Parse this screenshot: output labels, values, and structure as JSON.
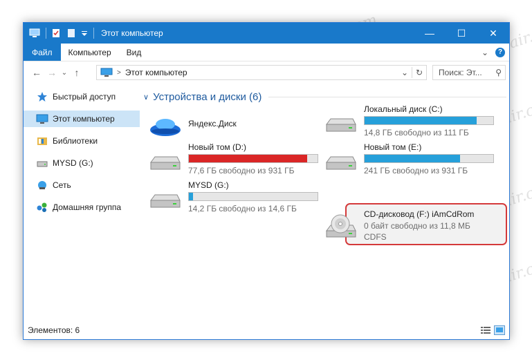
{
  "window": {
    "title": "Этот компьютер",
    "controls": {
      "minimize": "—",
      "maximize": "☐",
      "close": "✕"
    }
  },
  "ribbon": {
    "tabs": [
      "Файл",
      "Компьютер",
      "Вид"
    ],
    "help": "?",
    "expand": "⌄"
  },
  "nav": {
    "back": "←",
    "forward": "→",
    "recent": "⌄",
    "up": "↑",
    "address": "Этот компьютер",
    "crumb_sep": ">",
    "dropdown": "⌄",
    "refresh": "↻",
    "search_placeholder": "Поиск: Эт...",
    "search_icon": "⚲"
  },
  "sidebar": {
    "items": [
      {
        "label": "Быстрый доступ",
        "icon": "star-icon"
      },
      {
        "label": "Этот компьютер",
        "icon": "computer-icon",
        "selected": true
      },
      {
        "label": "Библиотеки",
        "icon": "library-icon"
      },
      {
        "label": "MYSD (G:)",
        "icon": "drive-icon"
      },
      {
        "label": "Сеть",
        "icon": "network-icon"
      },
      {
        "label": "Домашняя группа",
        "icon": "homegroup-icon"
      }
    ]
  },
  "content": {
    "group_chevron": "∨",
    "group_title": "Устройства и диски (6)",
    "drives": [
      {
        "id": "yandex",
        "name": "Яндекс.Диск"
      },
      {
        "id": "c",
        "name": "Локальный диск (C:)",
        "info": "14,8 ГБ свободно из 111 ГБ",
        "used_fraction": 0.87,
        "bar_color": "#26a0da"
      },
      {
        "id": "d",
        "name": "Новый том (D:)",
        "info": "77,6 ГБ свободно из 931 ГБ",
        "used_fraction": 0.92,
        "bar_color": "#da2626"
      },
      {
        "id": "e",
        "name": "Новый том (E:)",
        "info": "241 ГБ свободно из 931 ГБ",
        "used_fraction": 0.74,
        "bar_color": "#26a0da"
      },
      {
        "id": "g",
        "name": "MYSD (G:)",
        "info": "14,2 ГБ свободно из 14,6 ГБ",
        "used_fraction": 0.03,
        "bar_color": "#26a0da"
      },
      {
        "id": "f",
        "name": "CD-дисковод (F:) iAmCdRom",
        "info": "0 байт свободно из 11,8 МБ",
        "fs": "CDFS"
      }
    ]
  },
  "status": {
    "items_count": "Элементов: 6"
  },
  "watermark": "Soringpcrepair.com",
  "colors": {
    "accent": "#1979ca",
    "selection": "#cce4f7",
    "highlight_border": "#d4393a"
  }
}
